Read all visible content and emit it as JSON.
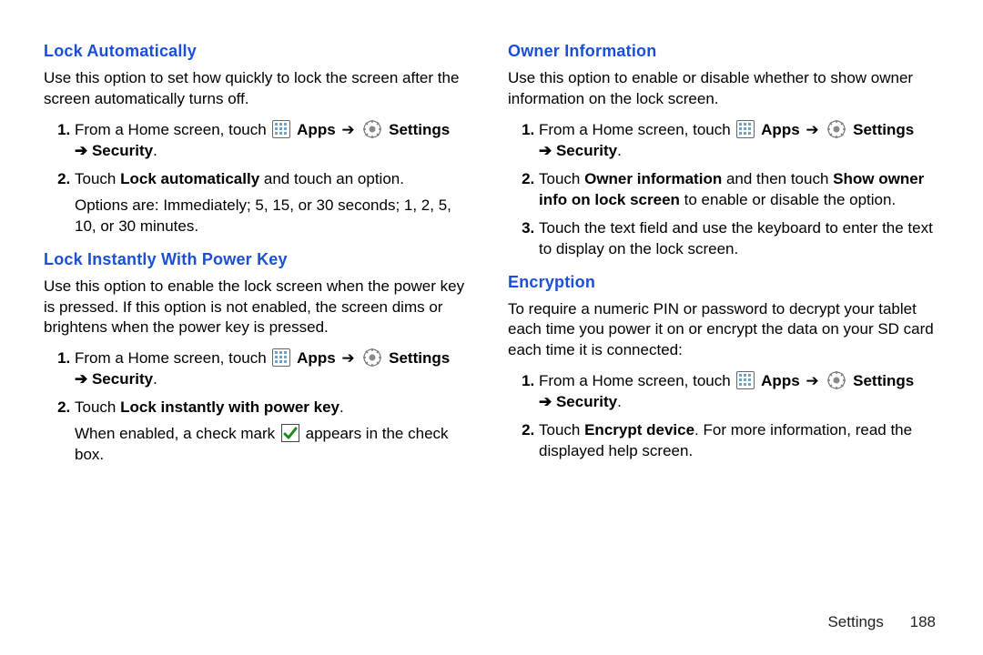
{
  "labels": {
    "apps": "Apps",
    "settings": "Settings",
    "arrow": "➔",
    "arrow_security": "➔ Security",
    "period": "."
  },
  "nav": {
    "from_home": "From a Home screen, touch "
  },
  "left": {
    "sec1": {
      "heading": "Lock Automatically",
      "intro": "Use this option to set how quickly to lock the screen after the screen automatically turns off.",
      "step2a": "Touch ",
      "step2b": "Lock automatically",
      "step2c": " and touch an option.",
      "step2sub": "Options are: Immediately; 5, 15, or 30 seconds; 1, 2, 5, 10, or 30 minutes."
    },
    "sec2": {
      "heading": "Lock Instantly With Power Key",
      "intro": "Use this option to enable the lock screen when the power key is pressed. If this option is not enabled, the screen dims or brightens when the power key is pressed.",
      "step2a": "Touch ",
      "step2b": "Lock instantly with power key",
      "step2suba": "When enabled, a check mark ",
      "step2subb": " appears in the check box."
    }
  },
  "right": {
    "sec1": {
      "heading": "Owner Information",
      "intro": "Use this option to enable or disable whether to show owner information on the lock screen.",
      "step2a": "Touch ",
      "step2b": "Owner information",
      "step2c": " and then touch ",
      "step2d": "Show owner info on lock screen",
      "step2e": " to enable or disable the option.",
      "step3": "Touch the text field and use the keyboard to enter the text to display on the lock screen."
    },
    "sec2": {
      "heading": "Encryption",
      "intro": "To require a numeric PIN or password to decrypt your tablet each time you power it on or encrypt the data on your SD card each time it is connected:",
      "step2a": "Touch ",
      "step2b": "Encrypt device",
      "step2c": ". For more information, read the displayed help screen."
    }
  },
  "footer": {
    "section": "Settings",
    "page": "188"
  }
}
